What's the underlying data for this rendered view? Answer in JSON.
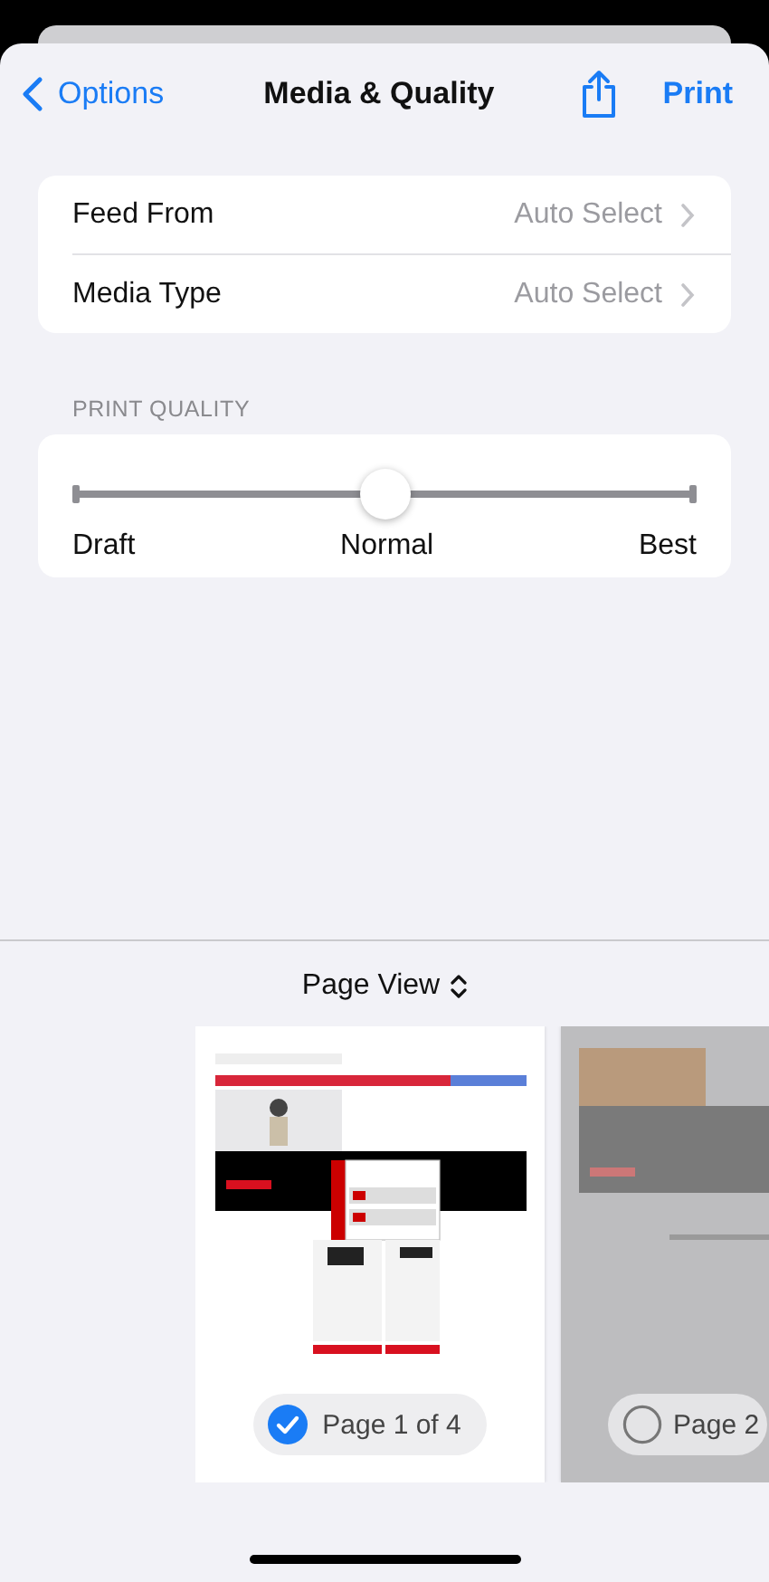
{
  "nav": {
    "back": "Options",
    "title": "Media & Quality",
    "action": "Print"
  },
  "media": [
    {
      "label": "Feed From",
      "value": "Auto Select"
    },
    {
      "label": "Media Type",
      "value": "Auto Select"
    }
  ],
  "print_quality": {
    "header": "PRINT QUALITY",
    "level": 0.5,
    "labels": [
      "Draft",
      "Normal",
      "Best"
    ]
  },
  "preview": {
    "view_menu": "Page View",
    "pages": [
      {
        "label": "Page 1 of 4",
        "selected": true
      },
      {
        "label": "Page 2",
        "selected": false
      }
    ]
  }
}
